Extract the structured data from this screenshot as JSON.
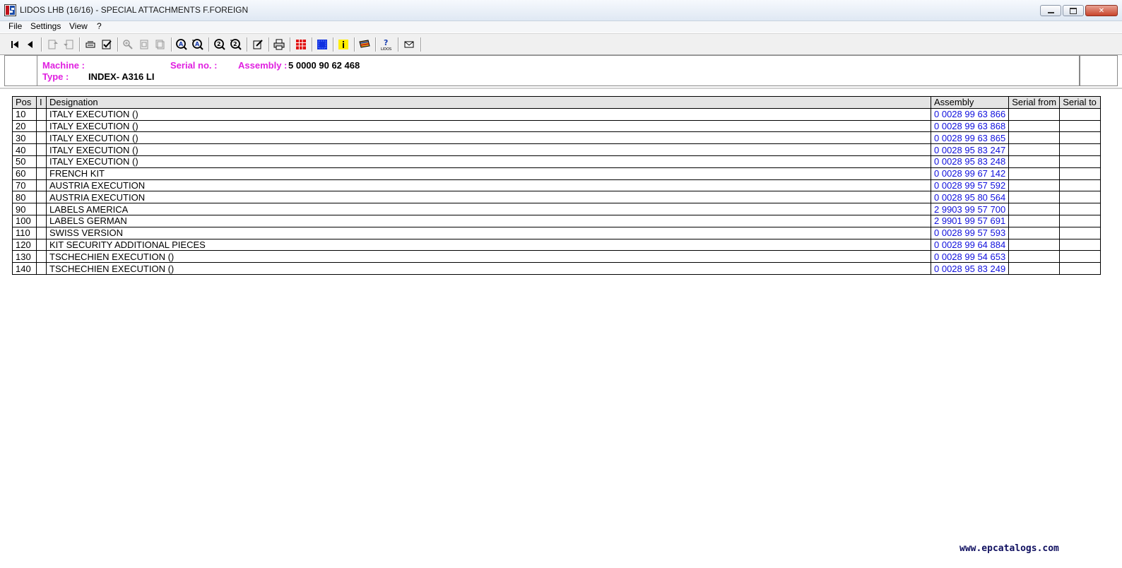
{
  "window": {
    "title": "LIDOS LHB (16/16) - SPECIAL ATTACHMENTS F.FOREIGN",
    "close_glyph": "✕"
  },
  "menu": {
    "items": [
      {
        "label": "File"
      },
      {
        "label": "Settings"
      },
      {
        "label": "View"
      },
      {
        "label": "?"
      }
    ]
  },
  "toolbar": {
    "icons": [
      "first-page-icon",
      "previous-page-icon",
      "copy-out-icon",
      "copy-in-icon",
      "print-list-icon",
      "checklist-icon",
      "zoom-in-icon",
      "page-icon",
      "page-stack-icon",
      "search-a-icon",
      "search-next-a-icon",
      "search-2-icon",
      "search-next-2-icon",
      "edit-icon",
      "printer-icon",
      "grid-red-icon",
      "grid-blue-icon",
      "info-icon",
      "flag-icon",
      "lidos-help-icon",
      "mail-icon"
    ]
  },
  "info": {
    "machine_label": "Machine :",
    "machine_value": "",
    "serial_label": "Serial no. :",
    "serial_value": "",
    "assembly_label": "Assembly :",
    "assembly_value": "5 0000 90 62 468",
    "type_label": "Type :",
    "type_value": "INDEX- A316 LI"
  },
  "table": {
    "columns": {
      "pos": "Pos",
      "i": "I",
      "designation": "Designation",
      "assembly": "Assembly",
      "serial_from": "Serial from",
      "serial_to": "Serial to"
    },
    "rows": [
      {
        "pos": "10",
        "designation": "ITALY EXECUTION ()",
        "assembly": "0 0028 99 63 866"
      },
      {
        "pos": "20",
        "designation": "ITALY EXECUTION ()",
        "assembly": "0 0028 99 63 868"
      },
      {
        "pos": "30",
        "designation": "ITALY EXECUTION ()",
        "assembly": "0 0028 99 63 865"
      },
      {
        "pos": "40",
        "designation": "ITALY EXECUTION ()",
        "assembly": "0 0028 95 83 247"
      },
      {
        "pos": "50",
        "designation": "ITALY EXECUTION ()",
        "assembly": "0 0028 95 83 248"
      },
      {
        "pos": "60",
        "designation": "FRENCH KIT",
        "assembly": "0 0028 99 67 142"
      },
      {
        "pos": "70",
        "designation": "AUSTRIA EXECUTION",
        "assembly": "0 0028 99 57 592"
      },
      {
        "pos": "80",
        "designation": "AUSTRIA EXECUTION",
        "assembly": "0 0028 95 80 564"
      },
      {
        "pos": "90",
        "designation": "LABELS AMERICA",
        "assembly": "2 9903 99 57 700"
      },
      {
        "pos": "100",
        "designation": "LABELS GERMAN",
        "assembly": "2 9901 99 57 691"
      },
      {
        "pos": "110",
        "designation": "SWISS VERSION",
        "assembly": "0 0028 99 57 593"
      },
      {
        "pos": "120",
        "designation": "KIT SECURITY ADDITIONAL PIECES",
        "assembly": "0 0028 99 64 884"
      },
      {
        "pos": "130",
        "designation": "TSCHECHIEN EXECUTION ()",
        "assembly": "0 0028 99 54 653"
      },
      {
        "pos": "140",
        "designation": "TSCHECHIEN EXECUTION ()",
        "assembly": "0 0028 95 83 249"
      }
    ]
  },
  "watermark": "www.epcatalogs.com",
  "colors": {
    "label_magenta": "#e020e0",
    "assembly_blue": "#1010dd"
  }
}
